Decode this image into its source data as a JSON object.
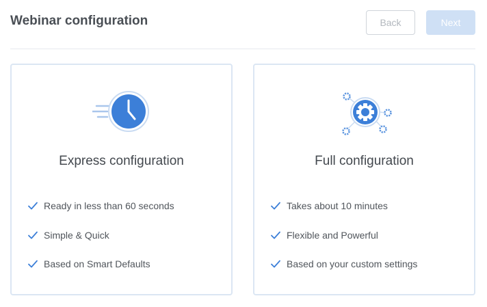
{
  "header": {
    "title": "Webinar configuration",
    "back_label": "Back",
    "next_label": "Next"
  },
  "cards": [
    {
      "title": "Express configuration",
      "icon": "clock-icon",
      "features": [
        "Ready in less than 60 seconds",
        "Simple & Quick",
        "Based on Smart Defaults"
      ]
    },
    {
      "title": "Full configuration",
      "icon": "gear-icon",
      "features": [
        "Takes about 10 minutes",
        "Flexible and Powerful",
        "Based on your custom settings"
      ]
    }
  ],
  "colors": {
    "accent": "#3c7fd8",
    "card_border": "#dbe6f3",
    "next_disabled": "#cfe0f5"
  }
}
